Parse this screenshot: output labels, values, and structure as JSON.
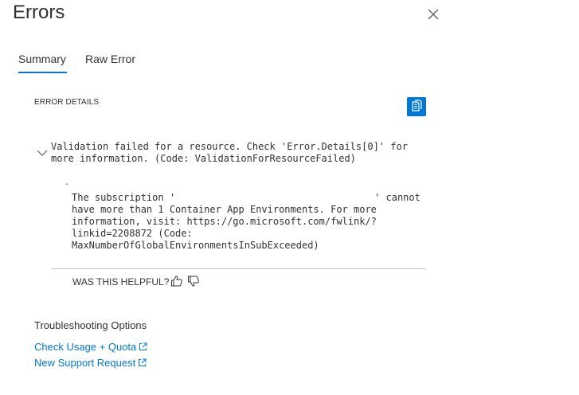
{
  "blade": {
    "title": "Errors"
  },
  "tabs": [
    {
      "label": "Summary",
      "selected": true
    },
    {
      "label": "Raw Error",
      "selected": false
    }
  ],
  "details": {
    "section_label": "ERROR DETAILS",
    "main_error": "Validation failed for a resource. Check 'Error.Details[0]' for more information. (Code: ValidationForResourceFailed)",
    "inner_prefix": "-",
    "inner_error_before": "The subscription '",
    "inner_error_after": "' cannot have more than 1 Container App Environments. For more information, visit: https://go.microsoft.com/fwlink/?linkid=2208872 (Code: MaxNumberOfGlobalEnvironmentsInSubExceeded)"
  },
  "feedback": {
    "label": "WAS THIS HELPFUL?"
  },
  "troubleshooting": {
    "title": "Troubleshooting Options",
    "links": [
      {
        "label": "Check Usage + Quota"
      },
      {
        "label": "New Support Request"
      }
    ]
  },
  "colors": {
    "accent": "#0078d4",
    "text": "#323130",
    "divider": "#c8c6c4"
  }
}
